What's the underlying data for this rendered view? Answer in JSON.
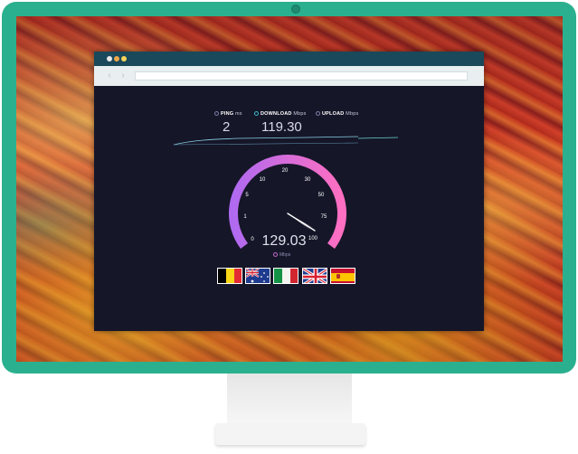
{
  "metrics": {
    "ping": {
      "icon": "ping-icon",
      "label": "PING",
      "unit": "ms",
      "value": "2"
    },
    "download": {
      "icon": "download-icon",
      "label": "DOWNLOAD",
      "unit": "Mbps",
      "value": "119.30"
    },
    "upload": {
      "icon": "upload-icon",
      "label": "UPLOAD",
      "unit": "Mbps",
      "value": ""
    }
  },
  "gauge": {
    "ticks": [
      "0",
      "1",
      "5",
      "10",
      "20",
      "30",
      "50",
      "75",
      "100"
    ],
    "speed": "129.03",
    "unit": "Mbps",
    "gradient_start": "#b06af0",
    "gradient_end": "#ff6fc1"
  },
  "flags": [
    "belgium-flag",
    "australia-flag",
    "italy-flag",
    "uk-flag",
    "spain-flag"
  ],
  "colors": {
    "monitor": "#2bb08f",
    "panel": "#161629",
    "titlebar": "#19495a",
    "accent": "#3bb8c8"
  }
}
